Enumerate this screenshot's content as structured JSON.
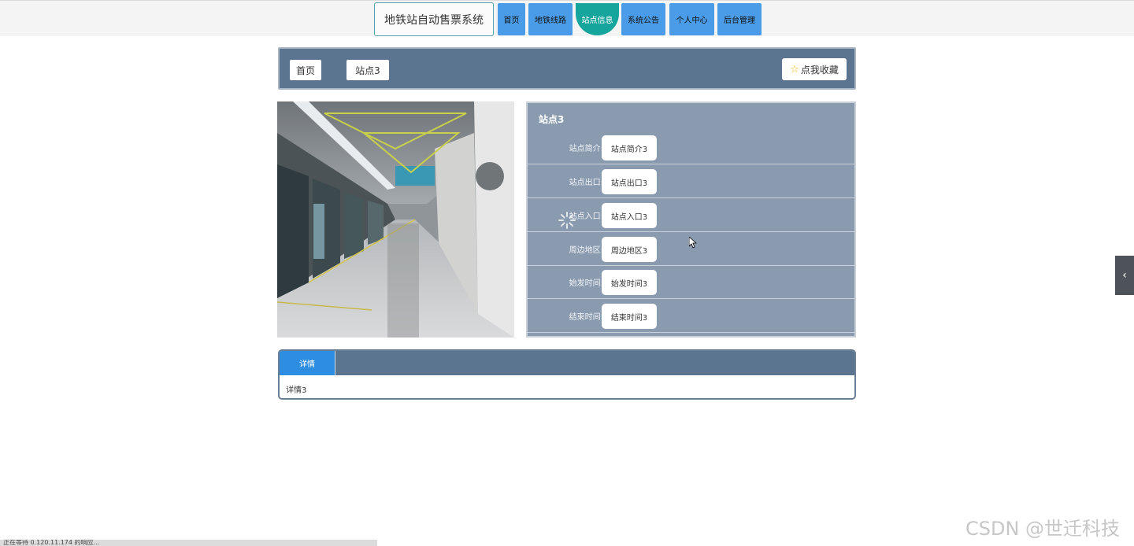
{
  "header": {
    "title": "地铁站自动售票系统",
    "nav": [
      {
        "label": "首页",
        "active": false
      },
      {
        "label": "地铁线路",
        "active": false
      },
      {
        "label": "站点信息",
        "active": true
      },
      {
        "label": "系统公告",
        "active": false
      },
      {
        "label": "个人中心",
        "active": false
      },
      {
        "label": "后台管理",
        "active": false
      }
    ]
  },
  "breadcrumb": {
    "home": "首页",
    "current": "站点3"
  },
  "favorite": {
    "label": "点我收藏",
    "icon": "star-icon"
  },
  "station": {
    "name": "站点3",
    "fields": [
      {
        "label": "站点简介:",
        "value": "站点简介3"
      },
      {
        "label": "站点出口:",
        "value": "站点出口3"
      },
      {
        "label": "站点入口:",
        "value": "站点入口3"
      },
      {
        "label": "周边地区:",
        "value": "周边地区3"
      },
      {
        "label": "始发时间:",
        "value": "始发时间3"
      },
      {
        "label": "结束时间:",
        "value": "结束时间3"
      }
    ]
  },
  "detail": {
    "tab": "详情",
    "content": "详情3"
  },
  "status_bar": "正在等待 0.120.11.174 的响应...",
  "watermark": "CSDN @世迁科技",
  "colors": {
    "nav_button": "#4a9ce8",
    "nav_active": "#15a59c",
    "panel_bg": "#5b7590",
    "info_bg": "#8a9bb0",
    "tab_active": "#2d8de0"
  }
}
